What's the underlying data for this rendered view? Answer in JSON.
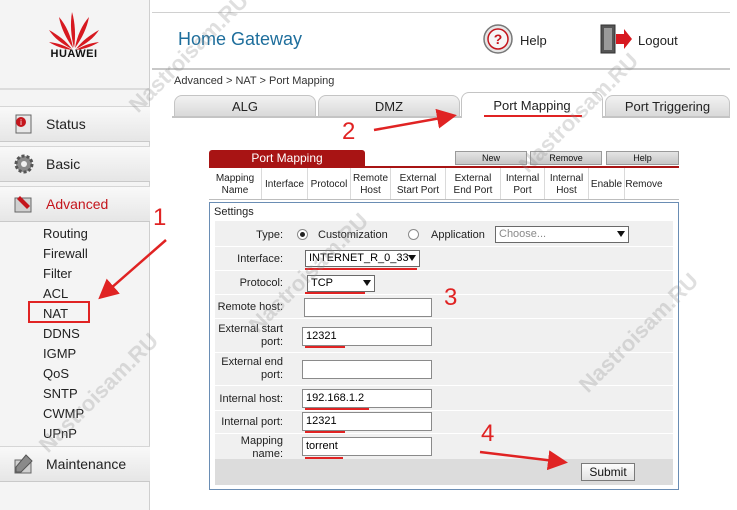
{
  "brand": {
    "logo_text": "HUAWEI"
  },
  "header": {
    "title": "Home Gateway",
    "help_label": "Help",
    "logout_label": "Logout"
  },
  "sidebar": {
    "main_items": [
      {
        "label": "Status",
        "icon": "status-info-icon"
      },
      {
        "label": "Basic",
        "icon": "gear-icon"
      },
      {
        "label": "Advanced",
        "icon": "advanced-tools-icon"
      },
      {
        "label": "Maintenance",
        "icon": "wrench-icon"
      }
    ],
    "advanced_items": [
      "Routing",
      "Firewall",
      "Filter",
      "ACL",
      "NAT",
      "DDNS",
      "IGMP",
      "QoS",
      "SNTP",
      "CWMP",
      "UPnP"
    ],
    "selected": "NAT"
  },
  "breadcrumb": "Advanced > NAT > Port Mapping",
  "tabs": [
    {
      "label": "ALG"
    },
    {
      "label": "DMZ"
    },
    {
      "label": "Port Mapping"
    },
    {
      "label": "Port Triggering"
    }
  ],
  "active_tab": "Port Mapping",
  "port_mapping": {
    "list_title": "Port Mapping",
    "buttons": {
      "new": "New",
      "remove": "Remove",
      "help": "Help"
    },
    "columns": [
      [
        "Mapping",
        "Name"
      ],
      [
        "Interface"
      ],
      [
        "Protocol"
      ],
      [
        "Remote",
        "Host"
      ],
      [
        "External",
        "Start Port"
      ],
      [
        "External",
        "End Port"
      ],
      [
        "Internal",
        "Port"
      ],
      [
        "Internal",
        "Host"
      ],
      [
        "Enable"
      ],
      [
        "Remove"
      ]
    ]
  },
  "settings": {
    "title": "Settings",
    "type_label": "Type:",
    "type_options": {
      "customization": "Customization",
      "application": "Application"
    },
    "type_selected": "Customization",
    "application_placeholder": "Choose...",
    "interface_label": "Interface:",
    "interface_value": "INTERNET_R_0_33",
    "protocol_label": "Protocol:",
    "protocol_value": "TCP",
    "remote_host_label": "Remote host:",
    "remote_host_value": "",
    "ext_start_label_1": "External start",
    "ext_start_label_2": "port:",
    "ext_start_value": "12321",
    "ext_end_label_1": "External end",
    "ext_end_label_2": "port:",
    "ext_end_value": "",
    "internal_host_label": "Internal host:",
    "internal_host_value": "192.168.1.2",
    "internal_port_label": "Internal port:",
    "internal_port_value": "12321",
    "mapping_name_label_1": "Mapping",
    "mapping_name_label_2": "name:",
    "mapping_name_value": "torrent",
    "submit_label": "Submit"
  },
  "annotations": {
    "step_numbers": [
      "1",
      "2",
      "3",
      "4"
    ],
    "accent_color": "#e02323"
  },
  "watermark": "Nastroisam.RU",
  "colors": {
    "brand_red": "#c4151c",
    "title_blue": "#1e6e9c",
    "list_header_red": "#a81414",
    "panel_border": "#6a8db4"
  }
}
